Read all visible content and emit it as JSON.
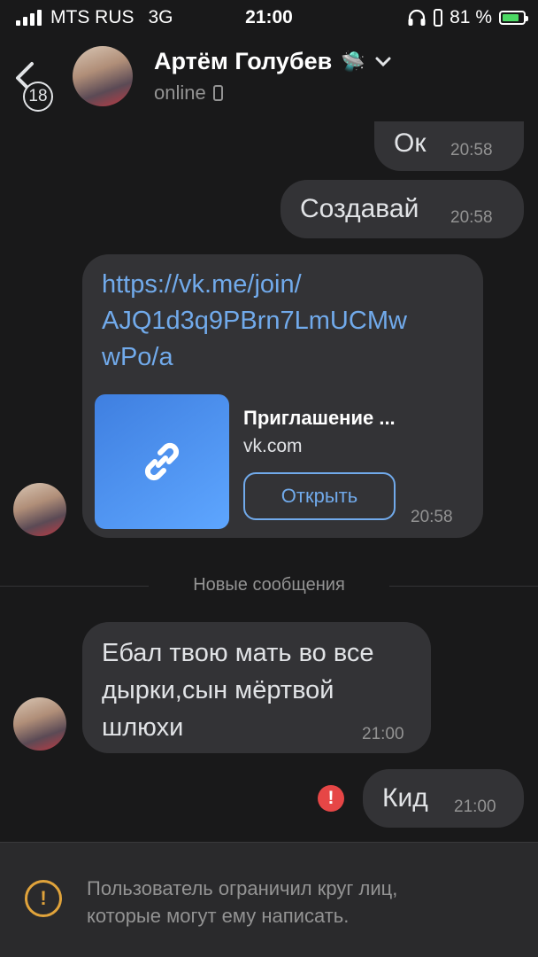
{
  "status_bar": {
    "carrier": "MTS RUS",
    "network": "3G",
    "time": "21:00",
    "battery": "81 %",
    "battery_level": 0.81,
    "icons": [
      "signal-icon",
      "headphones-icon",
      "battery-icon"
    ]
  },
  "header": {
    "unread_count": "18",
    "name": "Артём Голубев",
    "name_emoji": "🛸",
    "status": "online",
    "icons": [
      "back-chevron-icon",
      "chevron-down-icon",
      "mobile-device-icon"
    ]
  },
  "messages": [
    {
      "from": "me",
      "text": "Ок",
      "time": "20:58"
    },
    {
      "from": "me",
      "text": "Создавай",
      "time": "20:58"
    },
    {
      "from": "them",
      "link": "https://vk.me/join/AJQ1d3q9PBrn7LmUCMwwPo/a",
      "link_lines": [
        "https://vk.me/join/",
        "AJQ1d3q9PBrn7LmUCMw",
        "wPo/a"
      ],
      "preview": {
        "title": "Приглашение ...",
        "domain": "vk.com",
        "button": "Открыть"
      },
      "time": "20:58"
    },
    {
      "from": "them",
      "text_lines": [
        "Ебал твою мать во все",
        "дырки,сын мёртвой",
        "шлюхи"
      ],
      "time": "21:00"
    },
    {
      "from": "me",
      "text": "Кид",
      "time": "21:00",
      "error": "!"
    }
  ],
  "new_messages_label": "Новые сообщения",
  "footer": {
    "icon": "!",
    "text_lines": [
      "Пользователь ограничил круг лиц,",
      "которые могут ему написать."
    ]
  },
  "colors": {
    "background": "#19191a",
    "bubble": "#333336",
    "link": "#71aaeb",
    "error": "#e64646",
    "warning": "#e0a33b",
    "battery": "#4cd964"
  }
}
